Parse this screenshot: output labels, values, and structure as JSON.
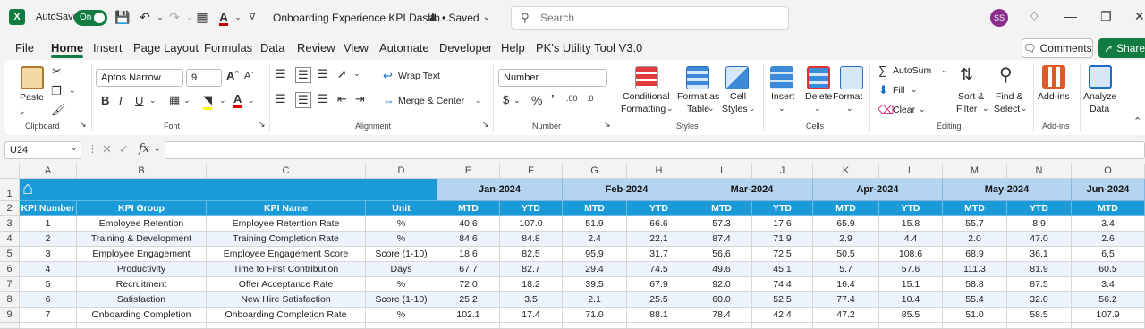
{
  "titlebar": {
    "autosave_label": "AutoSave",
    "autosave_state": "On",
    "doc_title": "Onboarding Experience KPI Dashb...",
    "saved_status": "• Saved",
    "search_placeholder": "Search",
    "avatar_initials": "SS"
  },
  "menu": {
    "items": [
      "File",
      "Home",
      "Insert",
      "Page Layout",
      "Formulas",
      "Data",
      "Review",
      "View",
      "Automate",
      "Developer",
      "Help",
      "PK's Utility Tool V3.0"
    ],
    "comments": "Comments",
    "share": "Share"
  },
  "ribbon": {
    "clipboard": {
      "paste": "Paste",
      "label": "Clipboard"
    },
    "font": {
      "name": "Aptos Narrow",
      "size": "9",
      "label": "Font"
    },
    "alignment": {
      "wrap": "Wrap Text",
      "merge": "Merge & Center",
      "label": "Alignment"
    },
    "number": {
      "format": "Number",
      "label": "Number"
    },
    "styles": {
      "cond1": "Conditional",
      "cond2": "Formatting",
      "fmt1": "Format as",
      "fmt2": "Table",
      "cell1": "Cell",
      "cell2": "Styles",
      "label": "Styles"
    },
    "cells": {
      "insert": "Insert",
      "delete": "Delete",
      "format": "Format",
      "label": "Cells"
    },
    "editing": {
      "autosum": "AutoSum",
      "fill": "Fill",
      "clear": "Clear",
      "sort1": "Sort &",
      "sort2": "Filter",
      "find1": "Find &",
      "find2": "Select",
      "label": "Editing"
    },
    "addins": {
      "addins": "Add-ins",
      "label": "Add-ins"
    },
    "analyze": {
      "line1": "Analyze",
      "line2": "Data"
    }
  },
  "formula_bar": {
    "name_box": "U24",
    "fx": "fx",
    "content": ""
  },
  "sheet": {
    "col_letters": [
      "A",
      "B",
      "C",
      "D",
      "E",
      "F",
      "G",
      "H",
      "I",
      "J",
      "K",
      "L",
      "M",
      "N",
      "O"
    ],
    "row_numbers": [
      "1",
      "2",
      "3",
      "4",
      "5",
      "6",
      "7",
      "8",
      "9"
    ],
    "months": [
      "Jan-2024",
      "Feb-2024",
      "Mar-2024",
      "Apr-2024",
      "May-2024",
      "Jun-2024"
    ],
    "headers": {
      "kpi_number": "KPI Number",
      "kpi_group": "KPI Group",
      "kpi_name": "KPI Name",
      "unit": "Unit",
      "mtd": "MTD",
      "ytd": "YTD"
    },
    "rows": [
      {
        "num": "1",
        "group": "Employee Retention",
        "name": "Employee Retention Rate",
        "unit": "%",
        "values": [
          "40.6",
          "107.0",
          "51.9",
          "66.6",
          "57.3",
          "17.6",
          "65.9",
          "15.8",
          "55.7",
          "8.9",
          "3.4"
        ]
      },
      {
        "num": "2",
        "group": "Training & Development",
        "name": "Training Completion Rate",
        "unit": "%",
        "values": [
          "84.6",
          "84.8",
          "2.4",
          "22.1",
          "87.4",
          "71.9",
          "2.9",
          "4.4",
          "2.0",
          "47.0",
          "2.6"
        ]
      },
      {
        "num": "3",
        "group": "Employee Engagement",
        "name": "Employee Engagement Score",
        "unit": "Score (1-10)",
        "values": [
          "18.6",
          "82.5",
          "95.9",
          "31.7",
          "56.6",
          "72.5",
          "50.5",
          "108.6",
          "68.9",
          "36.1",
          "6.5"
        ]
      },
      {
        "num": "4",
        "group": "Productivity",
        "name": "Time to First Contribution",
        "unit": "Days",
        "values": [
          "67.7",
          "82.7",
          "29.4",
          "74.5",
          "49.6",
          "45.1",
          "5.7",
          "57.6",
          "111.3",
          "81.9",
          "60.5"
        ]
      },
      {
        "num": "5",
        "group": "Recruitment",
        "name": "Offer Acceptance Rate",
        "unit": "%",
        "values": [
          "72.0",
          "18.2",
          "39.5",
          "67.9",
          "92.0",
          "74.4",
          "16.4",
          "15.1",
          "58.8",
          "87.5",
          "3.4"
        ]
      },
      {
        "num": "6",
        "group": "Satisfaction",
        "name": "New Hire Satisfaction",
        "unit": "Score (1-10)",
        "values": [
          "25.2",
          "3.5",
          "2.1",
          "25.5",
          "60.0",
          "52.5",
          "77.4",
          "10.4",
          "55.4",
          "32.0",
          "56.2"
        ]
      },
      {
        "num": "7",
        "group": "Onboarding Completion",
        "name": "Onboarding Completion Rate",
        "unit": "%",
        "values": [
          "102.1",
          "17.4",
          "71.0",
          "88.1",
          "78.4",
          "42.4",
          "47.2",
          "85.5",
          "51.0",
          "58.5",
          "107.9"
        ]
      }
    ]
  }
}
